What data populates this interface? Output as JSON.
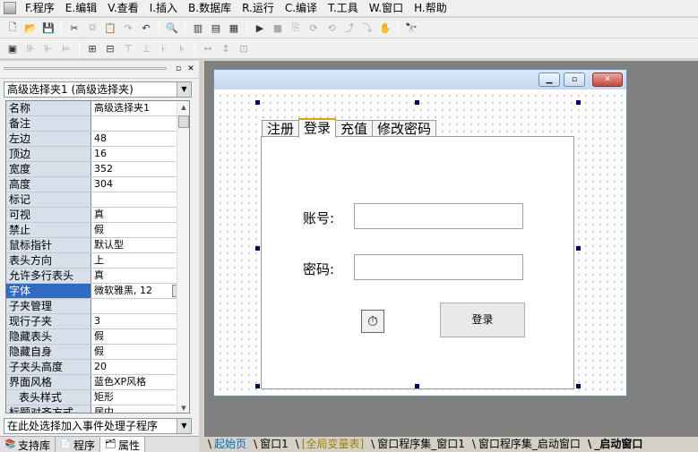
{
  "menu": [
    "F.程序",
    "E.编辑",
    "V.查看",
    "I.插入",
    "B.数据库",
    "R.运行",
    "C.编译",
    "T.工具",
    "W.窗口",
    "H.帮助"
  ],
  "toolbar": {
    "row1": [
      "new-icon",
      "open-icon",
      "save-icon",
      "cut-icon",
      "copy-icon",
      "paste-icon",
      "redo-icon",
      "undo-icon",
      "find-icon",
      "layout1-icon",
      "layout2-icon",
      "layout3-icon",
      "run-icon",
      "stop-icon",
      "step1-icon",
      "step2-icon",
      "step3-icon",
      "step4-icon",
      "hand-icon",
      "binoculars-icon"
    ],
    "row2": [
      "align-left-icon",
      "align-center-icon",
      "align-right-icon",
      "align-top-icon",
      "align-middle-icon",
      "align-bottom-icon",
      "same-width-icon",
      "same-height-icon",
      "same-size-icon",
      "hspace-icon",
      "vspace-icon",
      "grid-icon"
    ]
  },
  "panel": {
    "object_selector": "高级选择夹1 (高级选择夹)",
    "event_selector": "在此处选择加入事件处理子程序",
    "properties": [
      {
        "key": "名称",
        "value": "高级选择夹1"
      },
      {
        "key": "备注",
        "value": ""
      },
      {
        "key": "左边",
        "value": "48"
      },
      {
        "key": "顶边",
        "value": "16"
      },
      {
        "key": "宽度",
        "value": "352"
      },
      {
        "key": "高度",
        "value": "304"
      },
      {
        "key": "标记",
        "value": ""
      },
      {
        "key": "可视",
        "value": "真"
      },
      {
        "key": "禁止",
        "value": "假"
      },
      {
        "key": "鼠标指针",
        "value": "默认型"
      },
      {
        "key": "表头方向",
        "value": "上"
      },
      {
        "key": "允许多行表头",
        "value": "真"
      },
      {
        "key": "字体",
        "value": "微软雅黑, 12"
      },
      {
        "key": "子夹管理",
        "value": ""
      },
      {
        "key": "现行子夹",
        "value": "3"
      },
      {
        "key": "隐藏表头",
        "value": "假"
      },
      {
        "key": "隐藏自身",
        "value": "假"
      },
      {
        "key": "子夹头高度",
        "value": "20"
      },
      {
        "key": "界面风格",
        "value": "蓝色XP风格"
      },
      {
        "key": "表头样式",
        "value": "矩形"
      },
      {
        "key": "标题对齐方式",
        "value": "居中"
      }
    ],
    "tabs": [
      "支持库",
      "程序",
      "属性"
    ]
  },
  "form": {
    "tabs": [
      "注册",
      "登录",
      "充值",
      "修改密码"
    ],
    "account_label": "账号:",
    "password_label": "密码:",
    "account_value": "",
    "password_value": "",
    "login_button": "登录"
  },
  "doc_tabs": [
    "起始页",
    "窗口1",
    "[全局变量表]",
    "窗口程序集_窗口1",
    "窗口程序集_启动窗口",
    "_启动窗口"
  ]
}
